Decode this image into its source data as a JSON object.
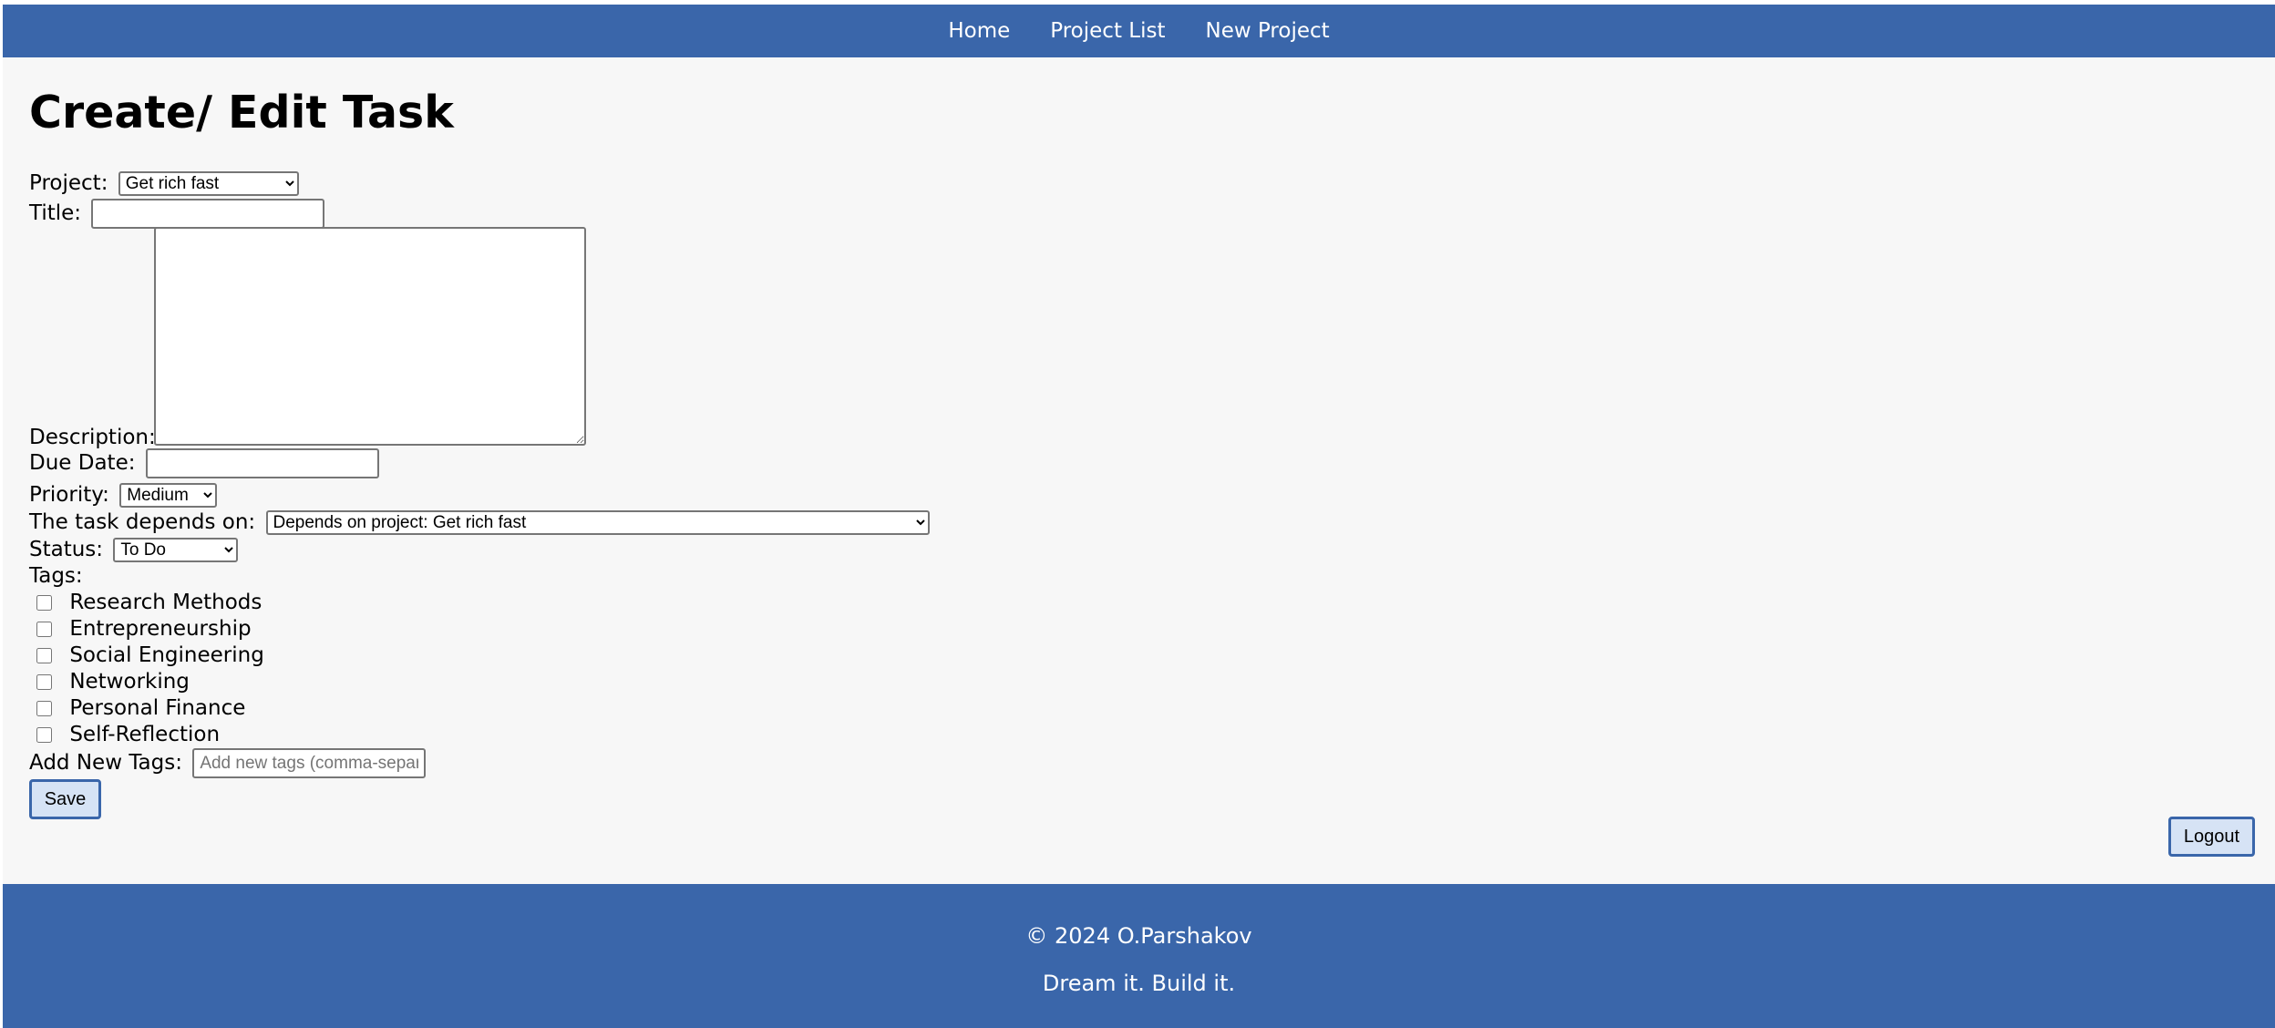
{
  "nav": {
    "items": [
      {
        "label": "Home"
      },
      {
        "label": "Project List"
      },
      {
        "label": "New Project"
      }
    ]
  },
  "page": {
    "title": "Create/ Edit Task"
  },
  "form": {
    "project": {
      "label": "Project:",
      "selected": "Get rich fast"
    },
    "title": {
      "label": "Title:",
      "value": ""
    },
    "description": {
      "label": "Description:",
      "value": ""
    },
    "due_date": {
      "label": "Due Date:",
      "value": ""
    },
    "priority": {
      "label": "Priority:",
      "selected": "Medium"
    },
    "depends_on": {
      "label": "The task depends on:",
      "selected": "Depends on project: Get rich fast"
    },
    "status": {
      "label": "Status:",
      "selected": "To Do"
    },
    "tags": {
      "label": "Tags:",
      "items": [
        {
          "label": "Research Methods",
          "checked": false
        },
        {
          "label": "Entrepreneurship",
          "checked": false
        },
        {
          "label": "Social Engineering",
          "checked": false
        },
        {
          "label": "Networking",
          "checked": false
        },
        {
          "label": "Personal Finance",
          "checked": false
        },
        {
          "label": "Self-Reflection",
          "checked": false
        }
      ]
    },
    "new_tags": {
      "label": "Add New Tags:",
      "placeholder": "Add new tags (comma-separated)"
    },
    "save_label": "Save"
  },
  "logout_label": "Logout",
  "footer": {
    "copyright": "© 2024 O.Parshakov",
    "tagline": "Dream it. Build it."
  },
  "colors": {
    "brand": "#3a66aa",
    "background": "#f7f7f7",
    "button_bg": "#d6e3f5"
  }
}
